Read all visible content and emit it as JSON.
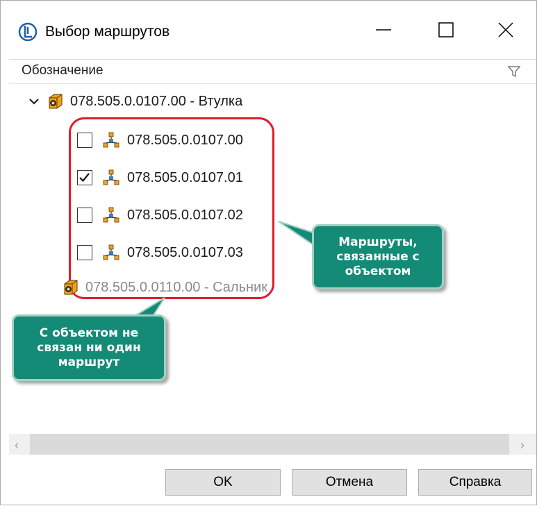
{
  "window": {
    "title": "Выбор маршрутов",
    "icons": {
      "app": "app-logo-icon",
      "minimize": "minimize-icon",
      "maximize": "maximize-icon",
      "close": "close-icon"
    }
  },
  "column_header": {
    "label": "Обозначение",
    "filter_icon": "filter-icon"
  },
  "tree": {
    "parents": [
      {
        "label": "078.505.0.0107.00 - Втулка",
        "expanded": true,
        "icon": "part-icon"
      },
      {
        "label": "078.505.0.0110.00 - Сальник",
        "expanded": false,
        "icon": "part-icon",
        "disabled": true
      }
    ],
    "routes": [
      {
        "label": "078.505.0.0107.00",
        "checked": false,
        "icon": "route-icon"
      },
      {
        "label": "078.505.0.0107.01",
        "checked": true,
        "icon": "route-icon"
      },
      {
        "label": "078.505.0.0107.02",
        "checked": false,
        "icon": "route-icon"
      },
      {
        "label": "078.505.0.0107.03",
        "checked": false,
        "icon": "route-icon"
      }
    ]
  },
  "callouts": {
    "routes": "Маршруты,\nсвязанные с\nобъектом",
    "no_route": "С объектом не\nсвязан ни один\nмаршрут"
  },
  "colors": {
    "callout_bg": "#138b76",
    "highlight": "#e11b2a"
  },
  "buttons": {
    "ok": "OK",
    "cancel": "Отмена",
    "help": "Справка"
  }
}
